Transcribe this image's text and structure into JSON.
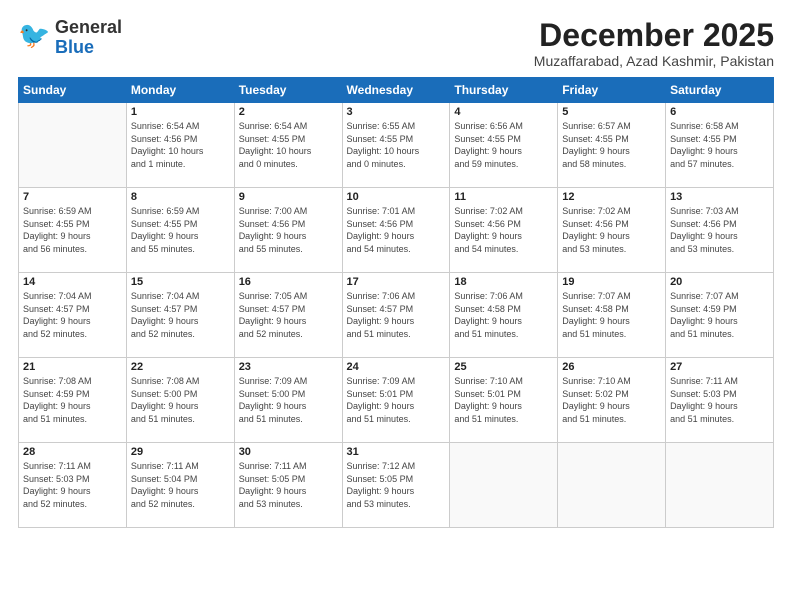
{
  "header": {
    "logo_general": "General",
    "logo_blue": "Blue",
    "month_title": "December 2025",
    "location": "Muzaffarabad, Azad Kashmir, Pakistan"
  },
  "weekdays": [
    "Sunday",
    "Monday",
    "Tuesday",
    "Wednesday",
    "Thursday",
    "Friday",
    "Saturday"
  ],
  "weeks": [
    [
      {
        "day": "",
        "info": ""
      },
      {
        "day": "1",
        "info": "Sunrise: 6:54 AM\nSunset: 4:56 PM\nDaylight: 10 hours\nand 1 minute."
      },
      {
        "day": "2",
        "info": "Sunrise: 6:54 AM\nSunset: 4:55 PM\nDaylight: 10 hours\nand 0 minutes."
      },
      {
        "day": "3",
        "info": "Sunrise: 6:55 AM\nSunset: 4:55 PM\nDaylight: 10 hours\nand 0 minutes."
      },
      {
        "day": "4",
        "info": "Sunrise: 6:56 AM\nSunset: 4:55 PM\nDaylight: 9 hours\nand 59 minutes."
      },
      {
        "day": "5",
        "info": "Sunrise: 6:57 AM\nSunset: 4:55 PM\nDaylight: 9 hours\nand 58 minutes."
      },
      {
        "day": "6",
        "info": "Sunrise: 6:58 AM\nSunset: 4:55 PM\nDaylight: 9 hours\nand 57 minutes."
      }
    ],
    [
      {
        "day": "7",
        "info": "Sunrise: 6:59 AM\nSunset: 4:55 PM\nDaylight: 9 hours\nand 56 minutes."
      },
      {
        "day": "8",
        "info": "Sunrise: 6:59 AM\nSunset: 4:55 PM\nDaylight: 9 hours\nand 55 minutes."
      },
      {
        "day": "9",
        "info": "Sunrise: 7:00 AM\nSunset: 4:56 PM\nDaylight: 9 hours\nand 55 minutes."
      },
      {
        "day": "10",
        "info": "Sunrise: 7:01 AM\nSunset: 4:56 PM\nDaylight: 9 hours\nand 54 minutes."
      },
      {
        "day": "11",
        "info": "Sunrise: 7:02 AM\nSunset: 4:56 PM\nDaylight: 9 hours\nand 54 minutes."
      },
      {
        "day": "12",
        "info": "Sunrise: 7:02 AM\nSunset: 4:56 PM\nDaylight: 9 hours\nand 53 minutes."
      },
      {
        "day": "13",
        "info": "Sunrise: 7:03 AM\nSunset: 4:56 PM\nDaylight: 9 hours\nand 53 minutes."
      }
    ],
    [
      {
        "day": "14",
        "info": "Sunrise: 7:04 AM\nSunset: 4:57 PM\nDaylight: 9 hours\nand 52 minutes."
      },
      {
        "day": "15",
        "info": "Sunrise: 7:04 AM\nSunset: 4:57 PM\nDaylight: 9 hours\nand 52 minutes."
      },
      {
        "day": "16",
        "info": "Sunrise: 7:05 AM\nSunset: 4:57 PM\nDaylight: 9 hours\nand 52 minutes."
      },
      {
        "day": "17",
        "info": "Sunrise: 7:06 AM\nSunset: 4:57 PM\nDaylight: 9 hours\nand 51 minutes."
      },
      {
        "day": "18",
        "info": "Sunrise: 7:06 AM\nSunset: 4:58 PM\nDaylight: 9 hours\nand 51 minutes."
      },
      {
        "day": "19",
        "info": "Sunrise: 7:07 AM\nSunset: 4:58 PM\nDaylight: 9 hours\nand 51 minutes."
      },
      {
        "day": "20",
        "info": "Sunrise: 7:07 AM\nSunset: 4:59 PM\nDaylight: 9 hours\nand 51 minutes."
      }
    ],
    [
      {
        "day": "21",
        "info": "Sunrise: 7:08 AM\nSunset: 4:59 PM\nDaylight: 9 hours\nand 51 minutes."
      },
      {
        "day": "22",
        "info": "Sunrise: 7:08 AM\nSunset: 5:00 PM\nDaylight: 9 hours\nand 51 minutes."
      },
      {
        "day": "23",
        "info": "Sunrise: 7:09 AM\nSunset: 5:00 PM\nDaylight: 9 hours\nand 51 minutes."
      },
      {
        "day": "24",
        "info": "Sunrise: 7:09 AM\nSunset: 5:01 PM\nDaylight: 9 hours\nand 51 minutes."
      },
      {
        "day": "25",
        "info": "Sunrise: 7:10 AM\nSunset: 5:01 PM\nDaylight: 9 hours\nand 51 minutes."
      },
      {
        "day": "26",
        "info": "Sunrise: 7:10 AM\nSunset: 5:02 PM\nDaylight: 9 hours\nand 51 minutes."
      },
      {
        "day": "27",
        "info": "Sunrise: 7:11 AM\nSunset: 5:03 PM\nDaylight: 9 hours\nand 51 minutes."
      }
    ],
    [
      {
        "day": "28",
        "info": "Sunrise: 7:11 AM\nSunset: 5:03 PM\nDaylight: 9 hours\nand 52 minutes."
      },
      {
        "day": "29",
        "info": "Sunrise: 7:11 AM\nSunset: 5:04 PM\nDaylight: 9 hours\nand 52 minutes."
      },
      {
        "day": "30",
        "info": "Sunrise: 7:11 AM\nSunset: 5:05 PM\nDaylight: 9 hours\nand 53 minutes."
      },
      {
        "day": "31",
        "info": "Sunrise: 7:12 AM\nSunset: 5:05 PM\nDaylight: 9 hours\nand 53 minutes."
      },
      {
        "day": "",
        "info": ""
      },
      {
        "day": "",
        "info": ""
      },
      {
        "day": "",
        "info": ""
      }
    ]
  ]
}
